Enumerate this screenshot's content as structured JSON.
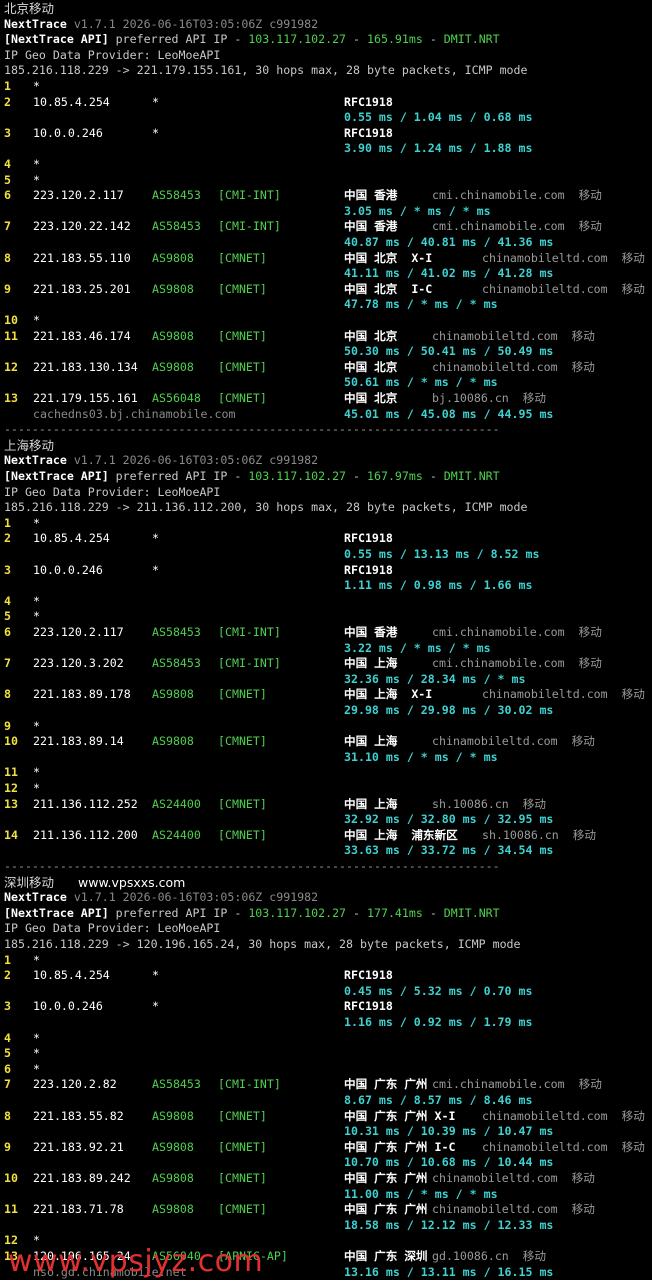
{
  "terminal": {
    "sections": [
      {
        "title": "北京移动",
        "url": "",
        "nexttrace_version": "v1.7.1 2026-06-16T03:05:06Z c991982",
        "api_line": {
          "prefix": "[NextTrace API]",
          "text": " preferred API IP - ",
          "ip": "103.117.102.27",
          "sep": " - ",
          "latency": "165.91ms",
          "sep2": " - ",
          "node": "DMIT.NRT"
        },
        "geo_provider": "IP Geo Data Provider: LeoMoeAPI",
        "route_line": "185.216.118.229 -> 221.179.155.161, 30 hops max, 28 byte packets, ICMP mode",
        "hops": [
          {
            "num": "1",
            "ip": "*"
          },
          {
            "num": "2",
            "ip": "10.85.4.254",
            "asn": "*",
            "geo": "RFC1918",
            "rtt": "0.55 ms / 1.04 ms / 0.68 ms"
          },
          {
            "num": "3",
            "ip": "10.0.0.246",
            "asn": "*",
            "geo": "RFC1918",
            "rtt": "3.90 ms / 1.24 ms / 1.88 ms"
          },
          {
            "num": "4",
            "ip": "*"
          },
          {
            "num": "5",
            "ip": "*"
          },
          {
            "num": "6",
            "ip": "223.120.2.117",
            "asn": "AS58453",
            "tag": "[CMI-INT]",
            "geo": "中国 香港",
            "domain": "cmi.chinamobile.com",
            "isp": "移动",
            "rtt": "3.05 ms / * ms / * ms"
          },
          {
            "num": "7",
            "ip": "223.120.22.142",
            "asn": "AS58453",
            "tag": "[CMI-INT]",
            "geo": "中国 香港",
            "domain": "cmi.chinamobile.com",
            "isp": "移动",
            "rtt": "40.87 ms / 40.81 ms / 41.36 ms"
          },
          {
            "num": "8",
            "ip": "221.183.55.110",
            "asn": "AS9808",
            "tag": "[CMNET]",
            "geo": "中国 北京  X-I",
            "domain": "chinamobileltd.com",
            "isp": "移动",
            "rtt": "41.11 ms / 41.02 ms / 41.28 ms"
          },
          {
            "num": "9",
            "ip": "221.183.25.201",
            "asn": "AS9808",
            "tag": "[CMNET]",
            "geo": "中国 北京  I-C",
            "domain": "chinamobileltd.com",
            "isp": "移动",
            "rtt": "47.78 ms / * ms / * ms"
          },
          {
            "num": "10",
            "ip": "*"
          },
          {
            "num": "11",
            "ip": "221.183.46.174",
            "asn": "AS9808",
            "tag": "[CMNET]",
            "geo": "中国 北京",
            "domain": "chinamobileltd.com",
            "isp": "移动",
            "rtt": "50.30 ms / 50.41 ms / 50.49 ms"
          },
          {
            "num": "12",
            "ip": "221.183.130.134",
            "asn": "AS9808",
            "tag": "[CMNET]",
            "geo": "中国 北京",
            "domain": "chinamobileltd.com",
            "isp": "移动",
            "rtt": "50.61 ms / * ms / * ms"
          },
          {
            "num": "13",
            "ip": "221.179.155.161",
            "asn": "AS56048",
            "tag": "[CMNET]",
            "geo": "中国 北京",
            "domain": "bj.10086.cn",
            "isp": "移动",
            "rtt": "45.01 ms / 45.08 ms / 44.95 ms",
            "hostname": "cachedns03.bj.chinamobile.com"
          }
        ]
      },
      {
        "title": "上海移动",
        "url": "",
        "nexttrace_version": "v1.7.1 2026-06-16T03:05:06Z c991982",
        "api_line": {
          "prefix": "[NextTrace API]",
          "text": " preferred API IP - ",
          "ip": "103.117.102.27",
          "sep": " - ",
          "latency": "167.97ms",
          "sep2": " - ",
          "node": "DMIT.NRT"
        },
        "geo_provider": "IP Geo Data Provider: LeoMoeAPI",
        "route_line": "185.216.118.229 -> 211.136.112.200, 30 hops max, 28 byte packets, ICMP mode",
        "hops": [
          {
            "num": "1",
            "ip": "*"
          },
          {
            "num": "2",
            "ip": "10.85.4.254",
            "asn": "*",
            "geo": "RFC1918",
            "rtt": "0.55 ms / 13.13 ms / 8.52 ms"
          },
          {
            "num": "3",
            "ip": "10.0.0.246",
            "asn": "*",
            "geo": "RFC1918",
            "rtt": "1.11 ms / 0.98 ms / 1.66 ms"
          },
          {
            "num": "4",
            "ip": "*"
          },
          {
            "num": "5",
            "ip": "*"
          },
          {
            "num": "6",
            "ip": "223.120.2.117",
            "asn": "AS58453",
            "tag": "[CMI-INT]",
            "geo": "中国 香港",
            "domain": "cmi.chinamobile.com",
            "isp": "移动",
            "rtt": "3.22 ms / * ms / * ms"
          },
          {
            "num": "7",
            "ip": "223.120.3.202",
            "asn": "AS58453",
            "tag": "[CMI-INT]",
            "geo": "中国 上海",
            "domain": "cmi.chinamobile.com",
            "isp": "移动",
            "rtt": "32.36 ms / 28.34 ms / * ms"
          },
          {
            "num": "8",
            "ip": "221.183.89.178",
            "asn": "AS9808",
            "tag": "[CMNET]",
            "geo": "中国 上海  X-I",
            "domain": "chinamobileltd.com",
            "isp": "移动",
            "rtt": "29.98 ms / 29.98 ms / 30.02 ms"
          },
          {
            "num": "9",
            "ip": "*"
          },
          {
            "num": "10",
            "ip": "221.183.89.14",
            "asn": "AS9808",
            "tag": "[CMNET]",
            "geo": "中国 上海",
            "domain": "chinamobileltd.com",
            "isp": "移动",
            "rtt": "31.10 ms / * ms / * ms"
          },
          {
            "num": "11",
            "ip": "*"
          },
          {
            "num": "12",
            "ip": "*"
          },
          {
            "num": "13",
            "ip": "211.136.112.252",
            "asn": "AS24400",
            "tag": "[CMNET]",
            "geo": "中国 上海",
            "domain": "sh.10086.cn",
            "isp": "移动",
            "rtt": "32.92 ms / 32.80 ms / 32.95 ms"
          },
          {
            "num": "14",
            "ip": "211.136.112.200",
            "asn": "AS24400",
            "tag": "[CMNET]",
            "geo": "中国 上海  浦东新区",
            "domain": "sh.10086.cn",
            "isp": "移动",
            "rtt": "33.63 ms / 33.72 ms / 34.54 ms"
          }
        ]
      },
      {
        "title": "深圳移动",
        "url": "www.vpsxxs.com",
        "nexttrace_version": "v1.7.1 2026-06-16T03:05:06Z c991982",
        "api_line": {
          "prefix": "[NextTrace API]",
          "text": " preferred API IP - ",
          "ip": "103.117.102.27",
          "sep": " - ",
          "latency": "177.41ms",
          "sep2": " - ",
          "node": "DMIT.NRT"
        },
        "geo_provider": "IP Geo Data Provider: LeoMoeAPI",
        "route_line": "185.216.118.229 -> 120.196.165.24, 30 hops max, 28 byte packets, ICMP mode",
        "hops": [
          {
            "num": "1",
            "ip": "*"
          },
          {
            "num": "2",
            "ip": "10.85.4.254",
            "asn": "*",
            "geo": "RFC1918",
            "rtt": "0.45 ms / 5.32 ms / 0.70 ms"
          },
          {
            "num": "3",
            "ip": "10.0.0.246",
            "asn": "*",
            "geo": "RFC1918",
            "rtt": "1.16 ms / 0.92 ms / 1.79 ms"
          },
          {
            "num": "4",
            "ip": "*"
          },
          {
            "num": "5",
            "ip": "*"
          },
          {
            "num": "6",
            "ip": "*"
          },
          {
            "num": "7",
            "ip": "223.120.2.82",
            "asn": "AS58453",
            "tag": "[CMI-INT]",
            "geo": "中国 广东 广州",
            "domain": "cmi.chinamobile.com",
            "isp": "移动",
            "rtt": "8.67 ms / 8.57 ms / 8.46 ms"
          },
          {
            "num": "8",
            "ip": "221.183.55.82",
            "asn": "AS9808",
            "tag": "[CMNET]",
            "geo": "中国 广东 广州 X-I",
            "domain": "chinamobileltd.com",
            "isp": "移动",
            "rtt": "10.31 ms / 10.39 ms / 10.47 ms"
          },
          {
            "num": "9",
            "ip": "221.183.92.21",
            "asn": "AS9808",
            "tag": "[CMNET]",
            "geo": "中国 广东 广州 I-C",
            "domain": "chinamobileltd.com",
            "isp": "移动",
            "rtt": "10.70 ms / 10.68 ms / 10.44 ms"
          },
          {
            "num": "10",
            "ip": "221.183.89.242",
            "asn": "AS9808",
            "tag": "[CMNET]",
            "geo": "中国 广东 广州",
            "domain": "chinamobileltd.com",
            "isp": "移动",
            "rtt": "11.00 ms / * ms / * ms"
          },
          {
            "num": "11",
            "ip": "221.183.71.78",
            "asn": "AS9808",
            "tag": "[CMNET]",
            "geo": "中国 广东 广州",
            "domain": "chinamobileltd.com",
            "isp": "移动",
            "rtt": "18.58 ms / 12.12 ms / 12.33 ms"
          },
          {
            "num": "12",
            "ip": "*"
          },
          {
            "num": "13",
            "ip": "120.196.165.24",
            "asn": "AS56040",
            "tag": "[APNIC-AP]",
            "geo": "中国 广东 深圳",
            "domain": "gd.10086.cn",
            "isp": "移动",
            "rtt": "13.16 ms / 13.11 ms / 16.15 ms",
            "hostname": "nso.gd.chinamobile.net"
          }
        ]
      }
    ],
    "divider": "-----------------------------------------------------------------------",
    "watermark": "www.vpsjyz.com",
    "colors": {
      "ip": "#4fd14f",
      "rtt": "#3fd0d0",
      "hop_num": "#f0e040",
      "watermark": "#e03030"
    }
  }
}
